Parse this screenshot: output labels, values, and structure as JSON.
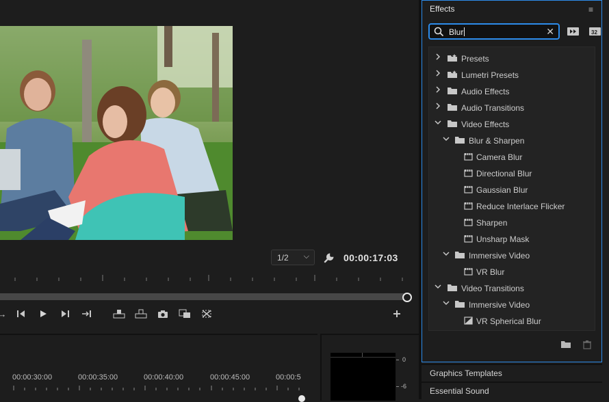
{
  "program_monitor": {
    "resolution": "1/2",
    "timecode": "00:00:17:03"
  },
  "timeline": {
    "timecodes": [
      "00:00:30:00",
      "00:00:35:00",
      "00:00:40:00",
      "00:00:45:00",
      "00:00:5"
    ]
  },
  "meter": {
    "labels": [
      "0",
      "-6"
    ]
  },
  "effects_panel": {
    "title": "Effects",
    "search_value": "Blur",
    "tree": [
      {
        "label": "Presets",
        "type": "preset-folder",
        "expanded": false
      },
      {
        "label": "Lumetri Presets",
        "type": "preset-folder",
        "expanded": false
      },
      {
        "label": "Audio Effects",
        "type": "folder",
        "expanded": false
      },
      {
        "label": "Audio Transitions",
        "type": "folder",
        "expanded": false
      },
      {
        "label": "Video Effects",
        "type": "folder",
        "expanded": true
      },
      {
        "label": "Blur & Sharpen",
        "type": "folder",
        "expanded": true
      },
      {
        "label": "Camera Blur",
        "type": "effect"
      },
      {
        "label": "Directional Blur",
        "type": "effect"
      },
      {
        "label": "Gaussian Blur",
        "type": "effect"
      },
      {
        "label": "Reduce Interlace Flicker",
        "type": "effect"
      },
      {
        "label": "Sharpen",
        "type": "effect"
      },
      {
        "label": "Unsharp Mask",
        "type": "effect"
      },
      {
        "label": "Immersive Video",
        "type": "folder",
        "expanded": true
      },
      {
        "label": "VR Blur",
        "type": "effect"
      },
      {
        "label": "Video Transitions",
        "type": "folder",
        "expanded": true
      },
      {
        "label": "Immersive Video",
        "type": "folder",
        "expanded": true
      },
      {
        "label": "VR Spherical Blur",
        "type": "transition"
      }
    ]
  },
  "panels": {
    "graphics_templates": "Graphics Templates",
    "essential_sound": "Essential Sound"
  },
  "colors": {
    "accent": "#2d8ceb",
    "bg": "#1d1d1d"
  }
}
